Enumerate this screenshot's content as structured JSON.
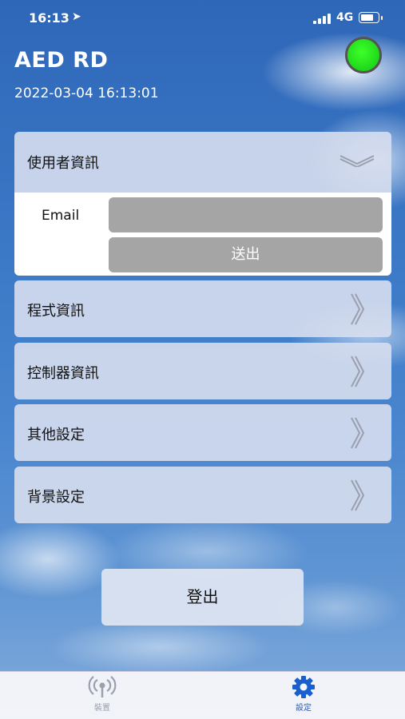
{
  "status_bar": {
    "time": "16:13",
    "location_arrow": "➤",
    "network": "4G"
  },
  "header": {
    "title": "AED RD",
    "datetime": "2022-03-04 16:13:01",
    "status_color": "#22e61a"
  },
  "user_info": {
    "title": "使用者資訊",
    "email_label": "Email",
    "email_value": "",
    "submit_label": "送出"
  },
  "menu": {
    "program_info": "程式資訊",
    "controller_info": "控制器資訊",
    "other_settings": "其他設定",
    "background_settings": "背景設定"
  },
  "logout_label": "登出",
  "tabs": {
    "devices": {
      "label": "裝置",
      "icon": "antenna-icon",
      "color": "#9aa0ad"
    },
    "settings": {
      "label": "設定",
      "icon": "gear-icon",
      "color": "#1a5fd0"
    }
  }
}
